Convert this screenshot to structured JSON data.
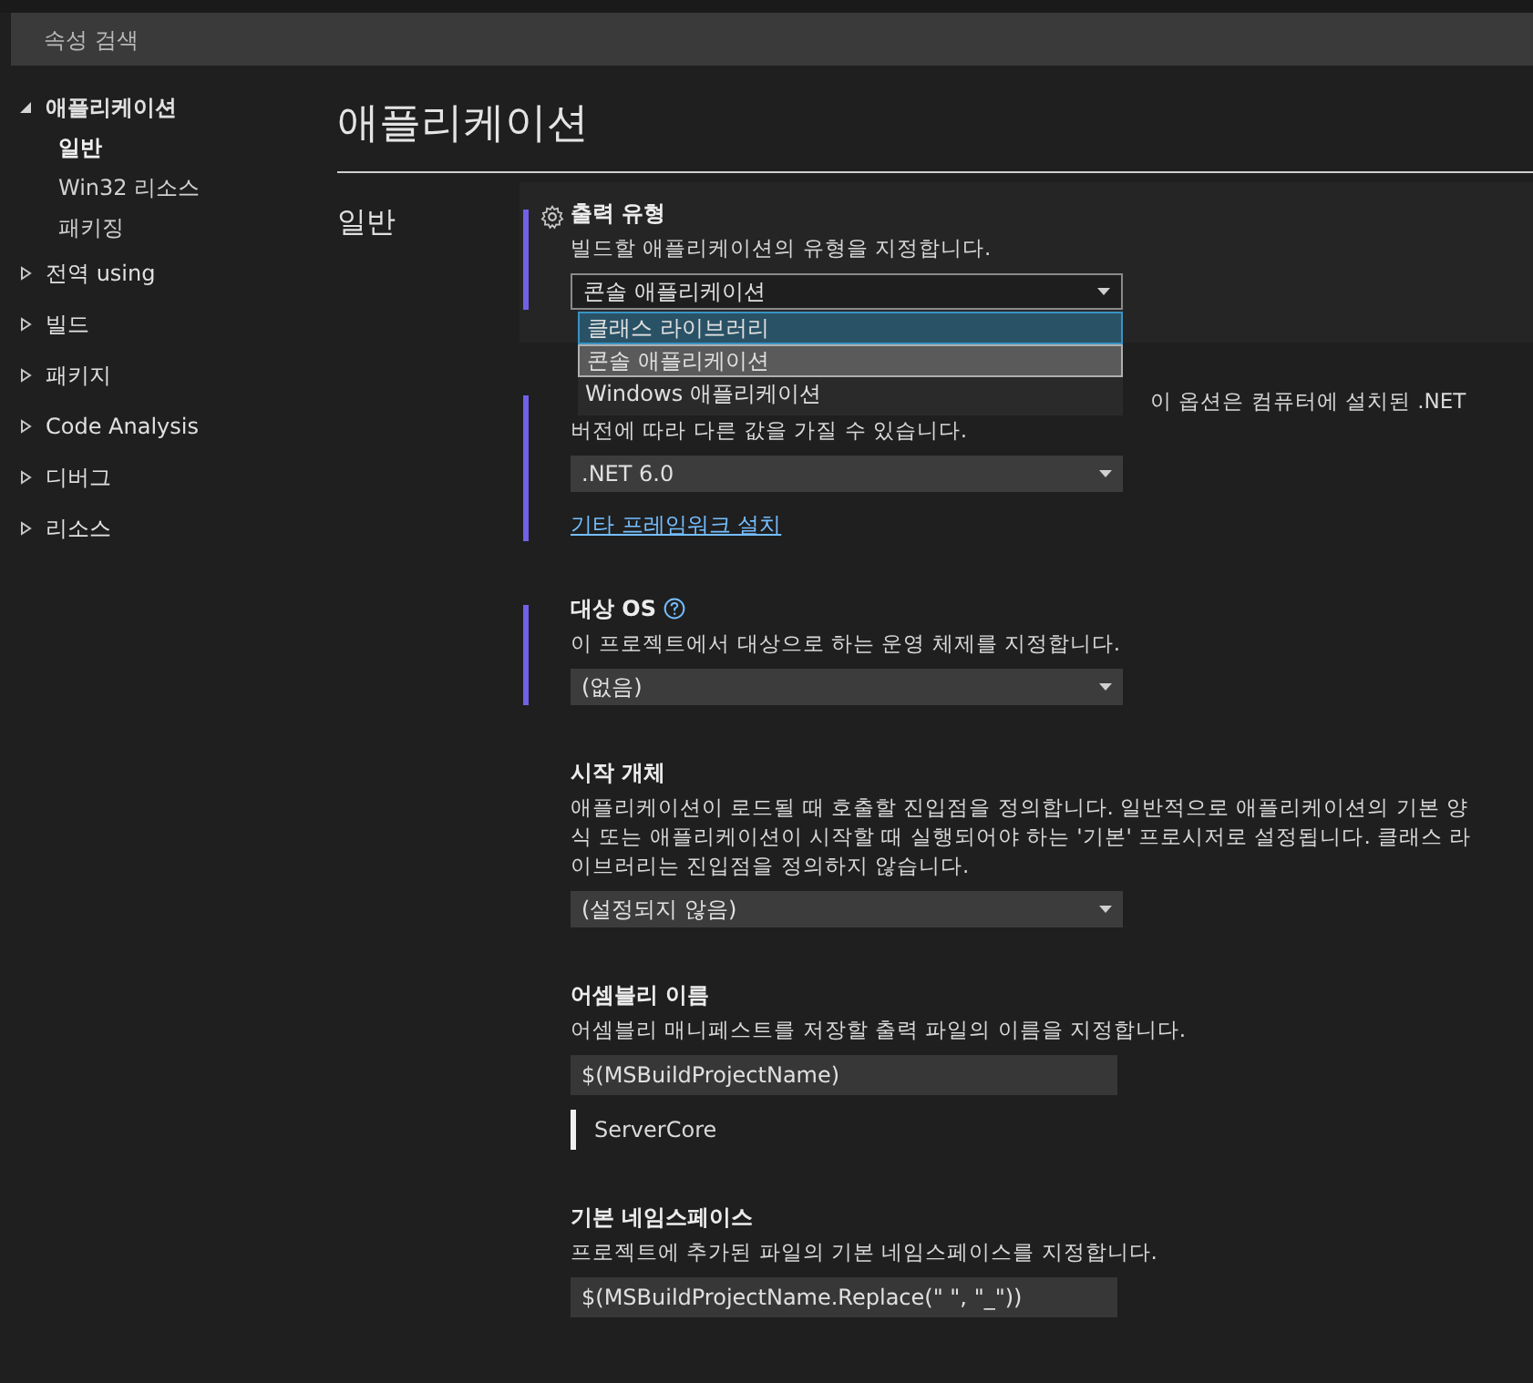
{
  "search": {
    "placeholder": "속성 검색"
  },
  "sidebar": {
    "items": [
      {
        "label": "애플리케이션",
        "expanded": true,
        "children": [
          {
            "label": "일반",
            "selected": true
          },
          {
            "label": "Win32 리소스",
            "selected": false
          },
          {
            "label": "패키징",
            "selected": false
          }
        ]
      },
      {
        "label": "전역 using",
        "expanded": false
      },
      {
        "label": "빌드",
        "expanded": false
      },
      {
        "label": "패키지",
        "expanded": false
      },
      {
        "label": "Code Analysis",
        "expanded": false
      },
      {
        "label": "디버그",
        "expanded": false
      },
      {
        "label": "리소스",
        "expanded": false
      }
    ]
  },
  "page_title": "애플리케이션",
  "group_label": "일반",
  "settings": [
    {
      "kind": "dropdown",
      "title": "출력 유형",
      "modified": true,
      "highlighted": true,
      "description": "빌드할 애플리케이션의 유형을 지정합니다.",
      "value": "콘솔 애플리케이션",
      "open": true,
      "options": [
        {
          "label": "클래스 라이브러리",
          "hovered": true,
          "selected": false
        },
        {
          "label": "콘솔 애플리케이션",
          "hovered": false,
          "selected": true
        },
        {
          "label": "Windows 애플리케이션",
          "hovered": false,
          "selected": false
        }
      ]
    },
    {
      "kind": "dropdown",
      "modified": true,
      "highlighted": false,
      "description_lines": [
        "이 옵션은 컴퓨터에 설치된 .NET",
        "버전에 따라 다른 값을 가질 수 있습니다."
      ],
      "value": ".NET 6.0",
      "open": false,
      "link": "기타 프레임워크 설치"
    },
    {
      "kind": "dropdown",
      "title": "대상 OS",
      "modified": true,
      "highlighted": false,
      "description": "이 프로젝트에서 대상으로 하는 운영 체제를 지정합니다.",
      "value": "(없음)",
      "open": false
    },
    {
      "kind": "dropdown",
      "title": "시작 개체",
      "modified": false,
      "highlighted": false,
      "description": "애플리케이션이 로드될 때 호출할 진입점을 정의합니다. 일반적으로 애플리케이션의 기본 양식 또는 애플리케이션이 시작할 때 실행되어야 하는 '기본' 프로시저로 설정됩니다. 클래스 라이브러리는 진입점을 정의하지 않습니다.",
      "value": "(설정되지 않음)",
      "open": false
    },
    {
      "kind": "text",
      "title": "어셈블리 이름",
      "modified": false,
      "highlighted": false,
      "description": "어셈블리 매니페스트를 저장할 출력 파일의 이름을 지정합니다.",
      "value": "$(MSBuildProjectName)",
      "evaluated": "ServerCore"
    },
    {
      "kind": "text",
      "title": "기본 네임스페이스",
      "modified": false,
      "highlighted": false,
      "description": "프로젝트에 추가된 파일의 기본 네임스페이스를 지정합니다.",
      "value": "$(MSBuildProjectName.Replace(\" \", \"_\"))"
    }
  ]
}
